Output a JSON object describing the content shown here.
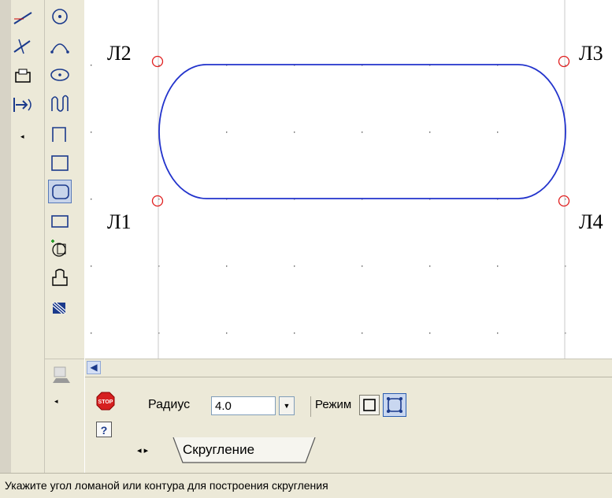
{
  "canvas": {
    "points": [
      {
        "name": "point-l2",
        "label": "Л2"
      },
      {
        "name": "point-l3",
        "label": "Л3"
      },
      {
        "name": "point-l1",
        "label": "Л1"
      },
      {
        "name": "point-l4",
        "label": "Л4"
      }
    ],
    "colors": {
      "contour": "#2233cc",
      "corner_marker": "#e02020",
      "grid": "#555555",
      "guide": "#c8c8c8"
    }
  },
  "properties": {
    "radius_label": "Радиус",
    "radius_value": "4.0",
    "mode_label": "Режим",
    "tab_label": "Скругление"
  },
  "status_bar": {
    "text": "Укажите угол ломаной или контура для построения скругления"
  },
  "toolbar": {
    "left_column_icons": [
      "fillet-line-icon",
      "trim-line-icon",
      "rectangle-stack-icon",
      "join-arrow-icon"
    ],
    "right_column_icons": [
      "circle-center-icon",
      "arc-icon",
      "ellipse-icon",
      "spline-icon",
      "polyline-icon",
      "rectangle-icon",
      "rounded-rectangle-icon",
      "rectangle-center-icon",
      "polygon-icon",
      "contour-icon",
      "hatch-icon",
      "collapsed-group-icon"
    ]
  }
}
